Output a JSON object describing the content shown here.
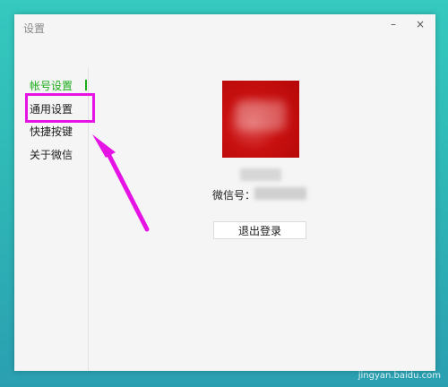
{
  "window": {
    "title": "设置",
    "controls": {
      "minimize": "–",
      "close": "×"
    }
  },
  "sidebar": {
    "items": [
      {
        "label": "帐号设置",
        "active": true
      },
      {
        "label": "通用设置",
        "active": false,
        "highlighted": true
      },
      {
        "label": "快捷按键",
        "active": false
      },
      {
        "label": "关于微信",
        "active": false
      }
    ]
  },
  "account": {
    "wechat_id_label": "微信号：",
    "logout_label": "退出登录"
  },
  "watermark": {
    "site": "jingyan.baidu.com"
  },
  "colors": {
    "accent": "#1aad19",
    "highlight": "#e514e5",
    "avatar": "#c81010"
  }
}
